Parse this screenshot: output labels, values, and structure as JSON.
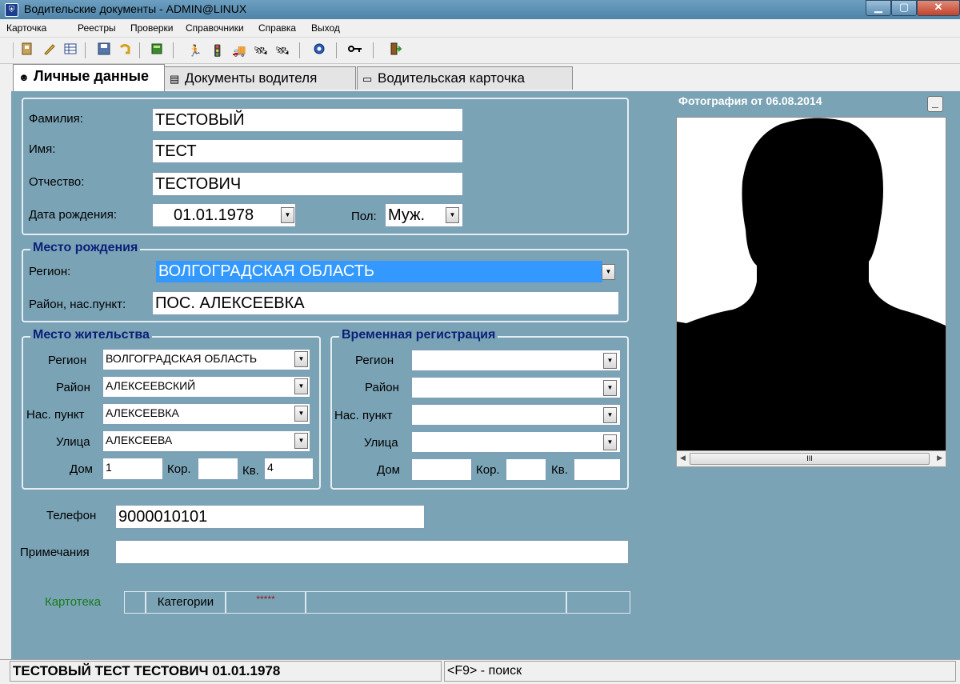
{
  "window": {
    "title": "Водительские документы - ADMIN@LINUX"
  },
  "menu": [
    "Карточка",
    "Реестры",
    "Проверки",
    "Справочники",
    "Справка",
    "Выход"
  ],
  "toolbar": {
    "icons": [
      "exit-door-icon",
      "pen-icon",
      "grid-icon",
      "save-icon",
      "undo-icon",
      "book-icon",
      "run-icon",
      "signal-icon",
      "truck-icon",
      "satellite-icon",
      "satellite-icon",
      "settings-icon",
      "key-icon",
      "exit-icon"
    ]
  },
  "tabs": {
    "personal": "Личные данные",
    "documents": "Документы водителя",
    "card": "Водительская карточка"
  },
  "personal": {
    "surname_label": "Фамилия:",
    "surname": "ТЕСТОВЫЙ",
    "name_label": "Имя:",
    "name": "ТЕСТ",
    "patronymic_label": "Отчество:",
    "patronymic": "ТЕСТОВИЧ",
    "birthdate_label": "Дата рождения:",
    "birthdate": "01.01.1978",
    "sex_label": "Пол:",
    "sex": "Муж."
  },
  "birthplace": {
    "title": "Место рождения",
    "region_label": "Регион:",
    "region": "ВОЛГОГРАДСКАЯ ОБЛАСТЬ",
    "locality_label": "Район, нас.пункт:",
    "locality": "ПОС. АЛЕКСЕЕВКА"
  },
  "residence": {
    "title": "Место жительства",
    "region_label": "Регион",
    "region": "ВОЛГОГРАДСКАЯ ОБЛАСТЬ",
    "district_label": "Район",
    "district": "АЛЕКСЕЕВСКИЙ",
    "settlement_label": "Нас. пункт",
    "settlement": "АЛЕКСЕЕВКА",
    "street_label": "Улица",
    "street": "АЛЕКСЕЕВА",
    "house_label": "Дом",
    "house": "1",
    "building_label": "Кор.",
    "building": "",
    "apt_label": "Кв.",
    "apt": "4"
  },
  "temp_registration": {
    "title": "Временная регистрация",
    "region_label": "Регион",
    "region": "",
    "district_label": "Район",
    "district": "",
    "settlement_label": "Нас. пункт",
    "settlement": "",
    "street_label": "Улица",
    "street": "",
    "house_label": "Дом",
    "house": "",
    "building_label": "Кор.",
    "building": "",
    "apt_label": "Кв.",
    "apt": ""
  },
  "contacts": {
    "phone_label": "Телефон",
    "phone": "9000010101",
    "notes_label": "Примечания",
    "notes": ""
  },
  "info_strip": {
    "kartoteka": "Картотека",
    "categories": "Категории",
    "stars": "*****",
    "colors": {
      "kartoteka": "#1a7a1a",
      "stars": "#8b1a1a"
    }
  },
  "photo": {
    "title": "Фотография от 06.08.2014",
    "collapse": "_",
    "scroll_thumb": "III"
  },
  "status": {
    "left": "ТЕСТОВЫЙ ТЕСТ ТЕСТОВИЧ 01.01.1978",
    "right": "<F9> - поиск"
  },
  "colors": {
    "panel": "#7aa3b6",
    "group_title": "#0b1f78",
    "selection": "#3399ff"
  }
}
